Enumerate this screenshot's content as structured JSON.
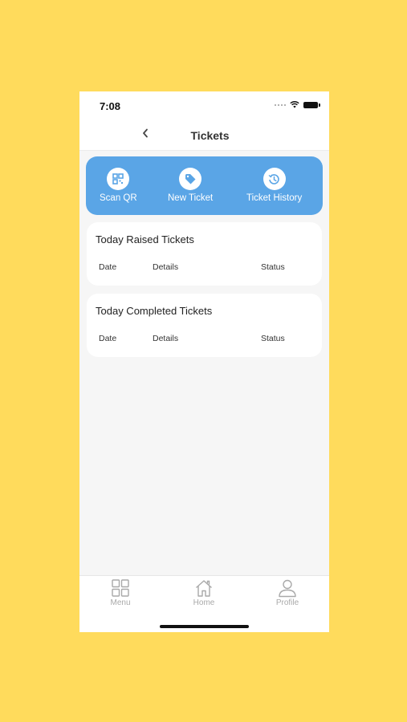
{
  "status_bar": {
    "time": "7:08"
  },
  "header": {
    "title": "Tickets"
  },
  "actions": [
    {
      "label": "Scan QR",
      "icon": "qr-code-icon"
    },
    {
      "label": "New Ticket",
      "icon": "tag-icon"
    },
    {
      "label": "Ticket History",
      "icon": "history-icon"
    }
  ],
  "sections": [
    {
      "title": "Today Raised Tickets",
      "columns": [
        "Date",
        "Details",
        "Status"
      ]
    },
    {
      "title": "Today Completed Tickets",
      "columns": [
        "Date",
        "Details",
        "Status"
      ]
    }
  ],
  "tabbar": [
    {
      "label": "Menu",
      "icon": "grid-icon"
    },
    {
      "label": "Home",
      "icon": "home-icon"
    },
    {
      "label": "Profile",
      "icon": "user-icon"
    }
  ],
  "colors": {
    "background": "#FFDB5C",
    "accent": "#5AA5E6",
    "screen": "#F6F6F6"
  }
}
